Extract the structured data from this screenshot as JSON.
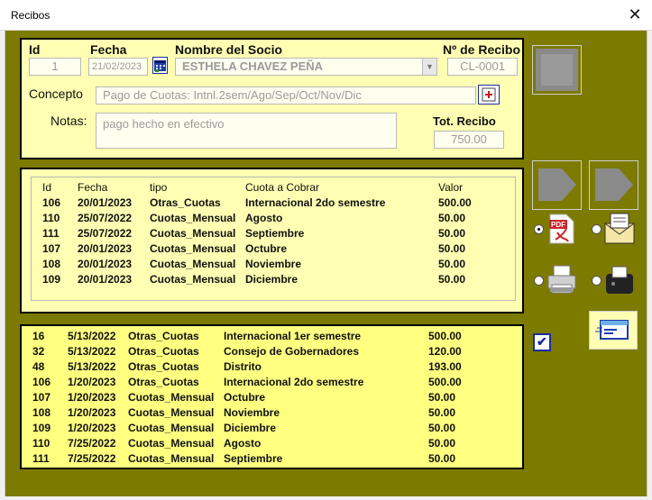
{
  "window": {
    "title": "Recibos",
    "close_glyph": "✕"
  },
  "form": {
    "id_label": "Id",
    "id_value": "1",
    "fecha_label": "Fecha",
    "fecha_value": "21/02/2023",
    "socio_label": "Nombre del Socio",
    "socio_value": "ESTHELA CHAVEZ PEÑA",
    "recibo_label": "Nº de Recibo",
    "recibo_value": "CL-0001",
    "concepto_label": "Concepto",
    "concepto_value": "Pago de Cuotas: Intnl.2sem/Ago/Sep/Oct/Nov/Dic",
    "notas_label": "Notas:",
    "notas_value": "pago hecho en efectivo",
    "tot_label": "Tot. Recibo",
    "tot_value": "750.00"
  },
  "mid_table": {
    "headers": [
      "Id",
      "Fecha",
      "tipo",
      "Cuota a Cobrar",
      "Valor"
    ],
    "rows": [
      [
        "106",
        "20/01/2023",
        "Otras_Cuotas",
        "Internacional 2do semestre",
        "500.00"
      ],
      [
        "110",
        "25/07/2022",
        "Cuotas_Mensual",
        "Agosto",
        "50.00"
      ],
      [
        "111",
        "25/07/2022",
        "Cuotas_Mensual",
        "Septiembre",
        "50.00"
      ],
      [
        "107",
        "20/01/2023",
        "Cuotas_Mensual",
        "Octubre",
        "50.00"
      ],
      [
        "108",
        "20/01/2023",
        "Cuotas_Mensual",
        "Noviembre",
        "50.00"
      ],
      [
        "109",
        "20/01/2023",
        "Cuotas_Mensual",
        "Diciembre",
        "50.00"
      ]
    ]
  },
  "bottom_table": {
    "rows": [
      [
        "16",
        "5/13/2022",
        "Otras_Cuotas",
        "Internacional 1er semestre",
        "500.00"
      ],
      [
        "32",
        "5/13/2022",
        "Otras_Cuotas",
        "Consejo de Gobernadores",
        "120.00"
      ],
      [
        "48",
        "5/13/2022",
        "Otras_Cuotas",
        "Distrito",
        "193.00"
      ],
      [
        "106",
        "1/20/2023",
        "Otras_Cuotas",
        "Internacional 2do semestre",
        "500.00"
      ],
      [
        "107",
        "1/20/2023",
        "Cuotas_Mensual",
        "Octubre",
        "50.00"
      ],
      [
        "108",
        "1/20/2023",
        "Cuotas_Mensual",
        "Noviembre",
        "50.00"
      ],
      [
        "109",
        "1/20/2023",
        "Cuotas_Mensual",
        "Diciembre",
        "50.00"
      ],
      [
        "110",
        "7/25/2022",
        "Cuotas_Mensual",
        "Agosto",
        "50.00"
      ],
      [
        "111",
        "7/25/2022",
        "Cuotas_Mensual",
        "Septiembre",
        "50.00"
      ]
    ]
  },
  "side": {
    "radio_pdf_selected": true,
    "radio_mail_selected": false,
    "radio_print_selected": false,
    "radio_receipt_selected": false,
    "checkbox_checked": true,
    "check_glyph": "✔",
    "pdf_text": "PDF"
  },
  "colors": {
    "background": "#7d7a00",
    "panel": "#ffffb3",
    "field": "#fffff0"
  }
}
